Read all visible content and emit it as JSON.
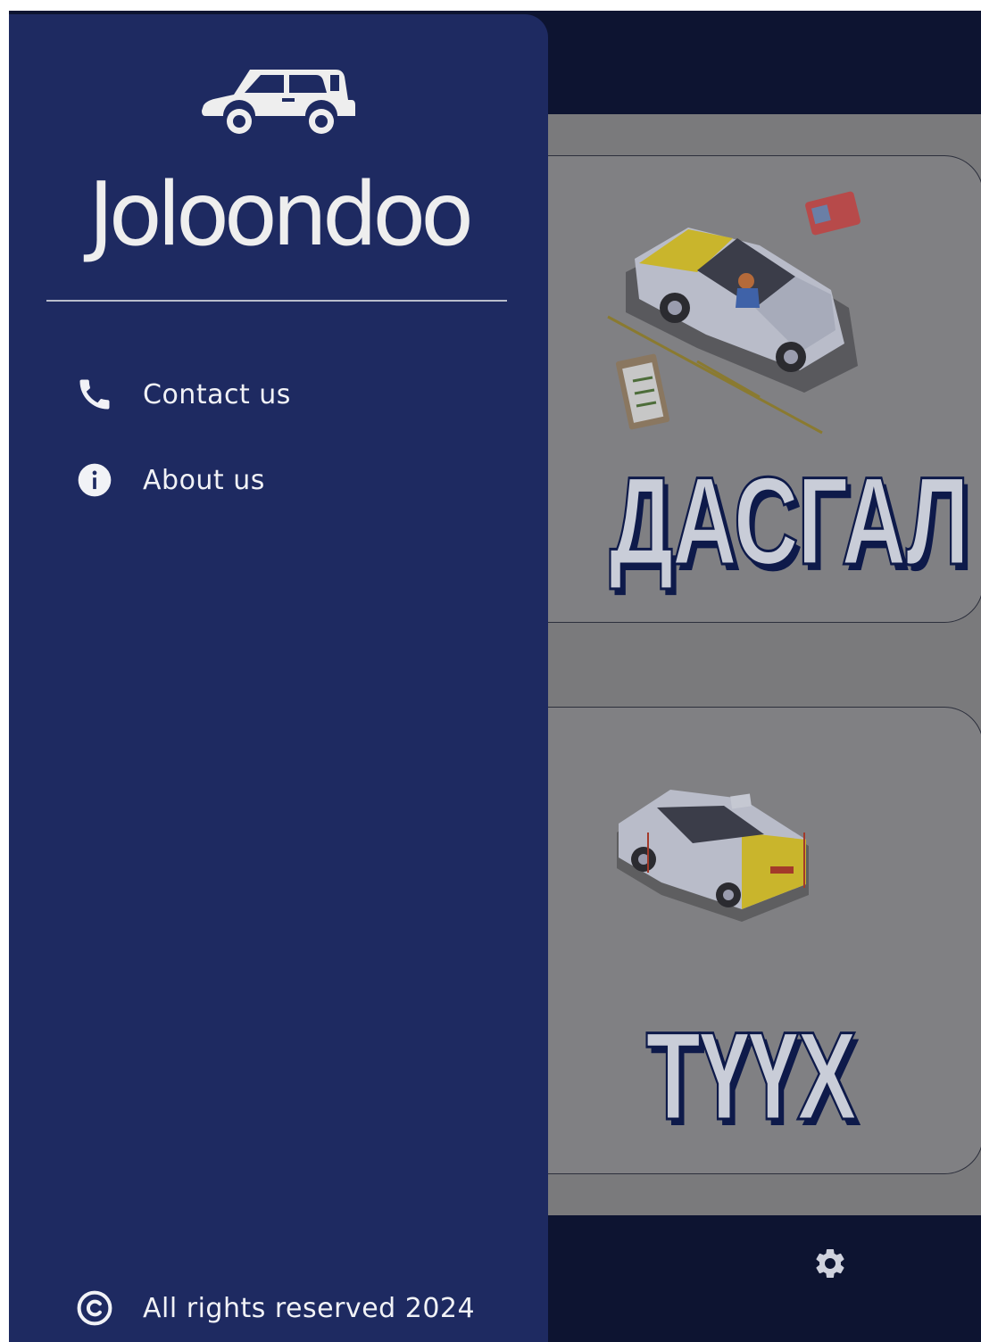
{
  "app": {
    "brand": "Joloondoo",
    "colors": {
      "drawer": "#1e2a61",
      "bars": "#0d1431",
      "overlay": "#7a7a7c",
      "text": "#f1f2f6"
    }
  },
  "drawer": {
    "logo_icon": "car-icon",
    "menu": [
      {
        "label": "Contact us",
        "icon": "phone-icon"
      },
      {
        "label": "About us",
        "icon": "info-icon"
      }
    ],
    "footer": {
      "label": "All rights reserved 2024",
      "icon": "copyright-icon"
    }
  },
  "background": {
    "cards": [
      {
        "title": "ДАСГАЛ",
        "illustration": "driving-lesson-car-illustration"
      },
      {
        "title": "ТҮҮХ",
        "illustration": "parked-car-illustration"
      }
    ],
    "bottom_nav": {
      "icon": "gear-icon"
    }
  }
}
